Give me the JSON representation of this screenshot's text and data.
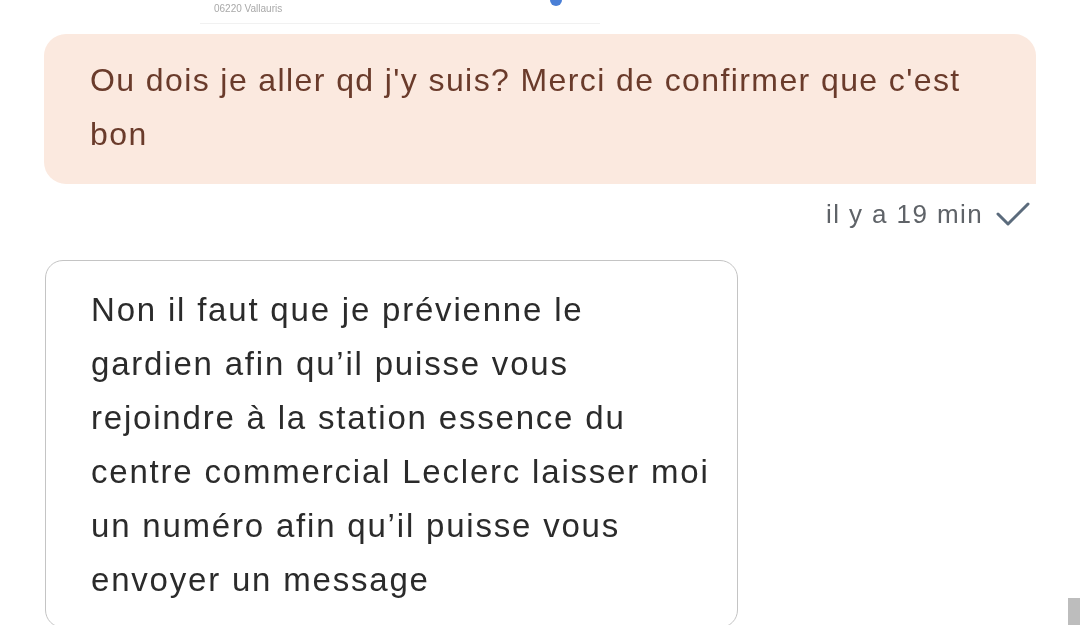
{
  "map_card": {
    "address": "06220 Vallauris"
  },
  "messages": [
    {
      "kind": "outgoing",
      "text": "Ou dois je aller qd j'y suis? Merci de confirmer que c'est bon",
      "time": "il y a 19 min",
      "delivered": true
    },
    {
      "kind": "incoming",
      "text": "Non il faut que je prévienne le gardien afin qu’il puisse vous rejoindre à la station essence du centre commercial Leclerc laisser moi un numéro afin qu’il puisse vous envoyer un message"
    }
  ]
}
